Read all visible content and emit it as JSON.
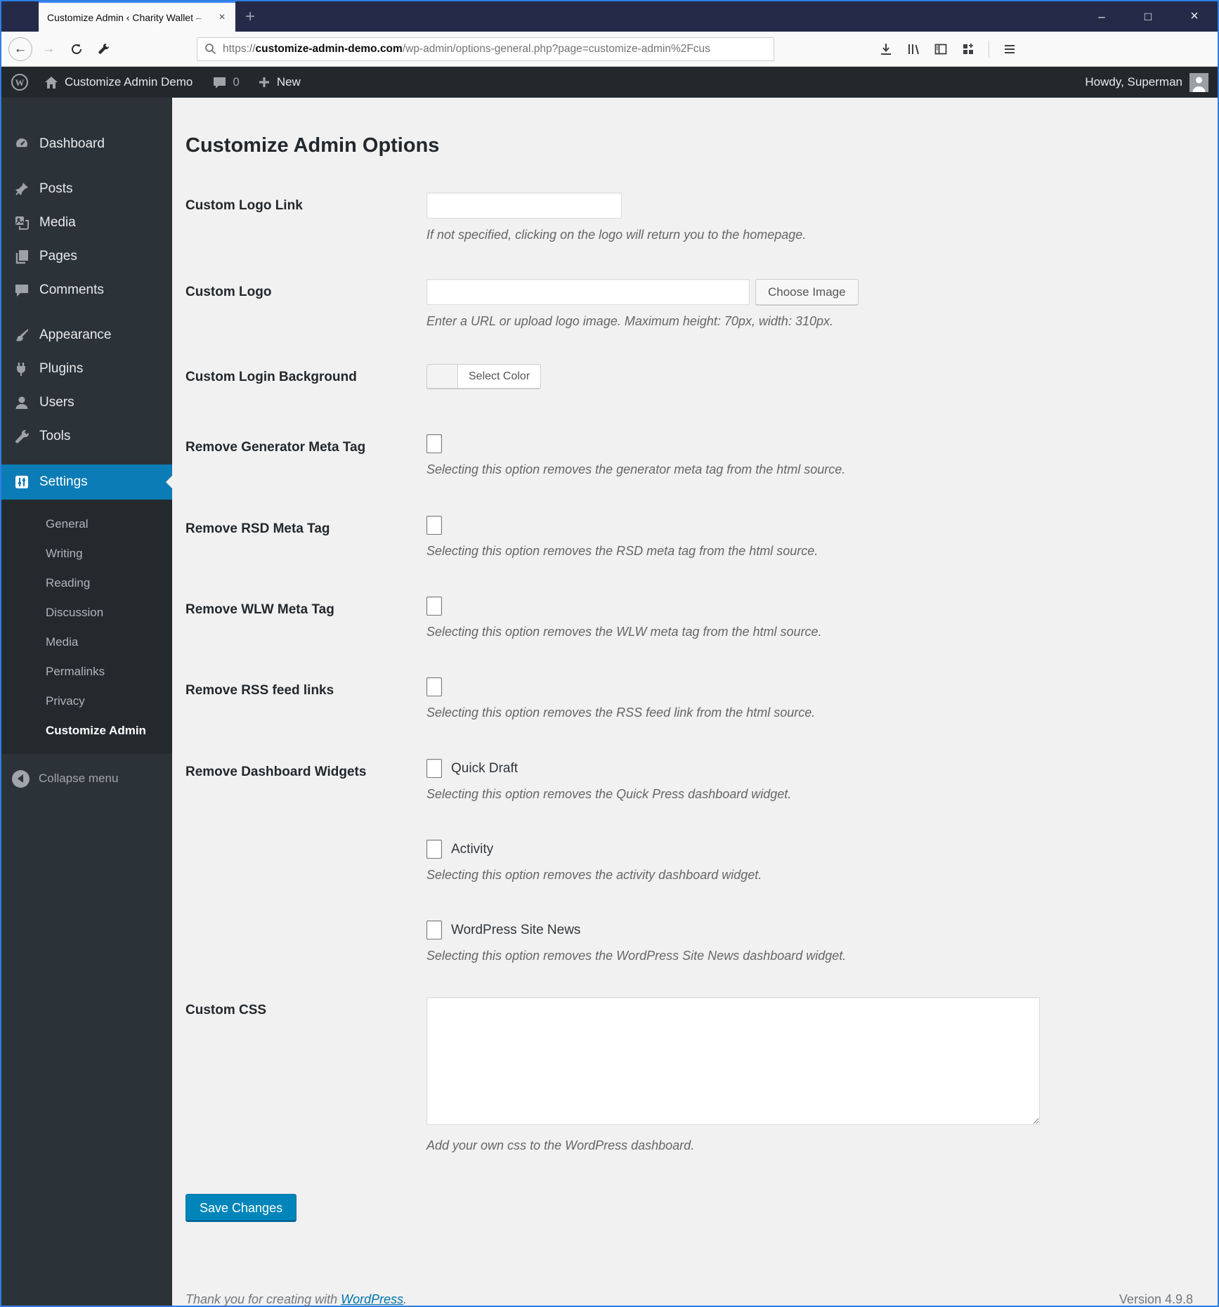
{
  "window": {
    "controls": {
      "minimize": "–",
      "maximize": "□",
      "close": "×"
    }
  },
  "browser": {
    "tab": {
      "title": "Customize Admin ‹ Charity Wallet –",
      "close_glyph": "×",
      "new_tab_glyph": "+"
    },
    "url": {
      "scheme": "https://",
      "host": "customize-admin-demo.com",
      "path": "/wp-admin/options-general.php?page=customize-admin%2Fcus"
    }
  },
  "admin_bar": {
    "site_name": "Customize Admin Demo",
    "comment_count": "0",
    "new_label": "New",
    "howdy": "Howdy, Superman"
  },
  "sidebar": {
    "items": [
      {
        "label": "Dashboard"
      },
      {
        "label": "Posts"
      },
      {
        "label": "Media"
      },
      {
        "label": "Pages"
      },
      {
        "label": "Comments"
      },
      {
        "label": "Appearance"
      },
      {
        "label": "Plugins"
      },
      {
        "label": "Users"
      },
      {
        "label": "Tools"
      },
      {
        "label": "Settings"
      }
    ],
    "submenu": [
      {
        "label": "General"
      },
      {
        "label": "Writing"
      },
      {
        "label": "Reading"
      },
      {
        "label": "Discussion"
      },
      {
        "label": "Media"
      },
      {
        "label": "Permalinks"
      },
      {
        "label": "Privacy"
      },
      {
        "label": "Customize Admin"
      }
    ],
    "collapse_label": "Collapse menu"
  },
  "main": {
    "heading": "Customize Admin Options",
    "rows": {
      "logo_link": {
        "label": "Custom Logo Link",
        "help": "If not specified, clicking on the logo will return you to the homepage."
      },
      "logo": {
        "label": "Custom Logo",
        "button": "Choose Image",
        "help": "Enter a URL or upload logo image. Maximum height: 70px, width: 310px."
      },
      "login_bg": {
        "label": "Custom Login Background",
        "button": "Select Color"
      },
      "generator": {
        "label": "Remove Generator Meta Tag",
        "help": "Selecting this option removes the generator meta tag from the html source."
      },
      "rsd": {
        "label": "Remove RSD Meta Tag",
        "help": "Selecting this option removes the RSD meta tag from the html source."
      },
      "wlw": {
        "label": "Remove WLW Meta Tag",
        "help": "Selecting this option removes the WLW meta tag from the html source."
      },
      "rss": {
        "label": "Remove RSS feed links",
        "help": "Selecting this option removes the RSS feed link from the html source."
      },
      "widgets": {
        "label": "Remove Dashboard Widgets",
        "options": [
          {
            "label": "Quick Draft",
            "help": "Selecting this option removes the Quick Press dashboard widget."
          },
          {
            "label": "Activity",
            "help": "Selecting this option removes the activity dashboard widget."
          },
          {
            "label": "WordPress Site News",
            "help": "Selecting this option removes the WordPress Site News dashboard widget."
          }
        ]
      },
      "css": {
        "label": "Custom CSS",
        "help": "Add your own css to the WordPress dashboard."
      }
    },
    "save_label": "Save Changes",
    "footer": {
      "thanks_prefix": "Thank you for creating with ",
      "link_text": "WordPress",
      "suffix": ".",
      "version": "Version 4.9.8"
    }
  },
  "colors": {
    "accent": "#0073aa",
    "primary_button": "#0085ba",
    "menu_highlight": "#0b7cb5",
    "admin_bar_bg": "#23282d"
  }
}
